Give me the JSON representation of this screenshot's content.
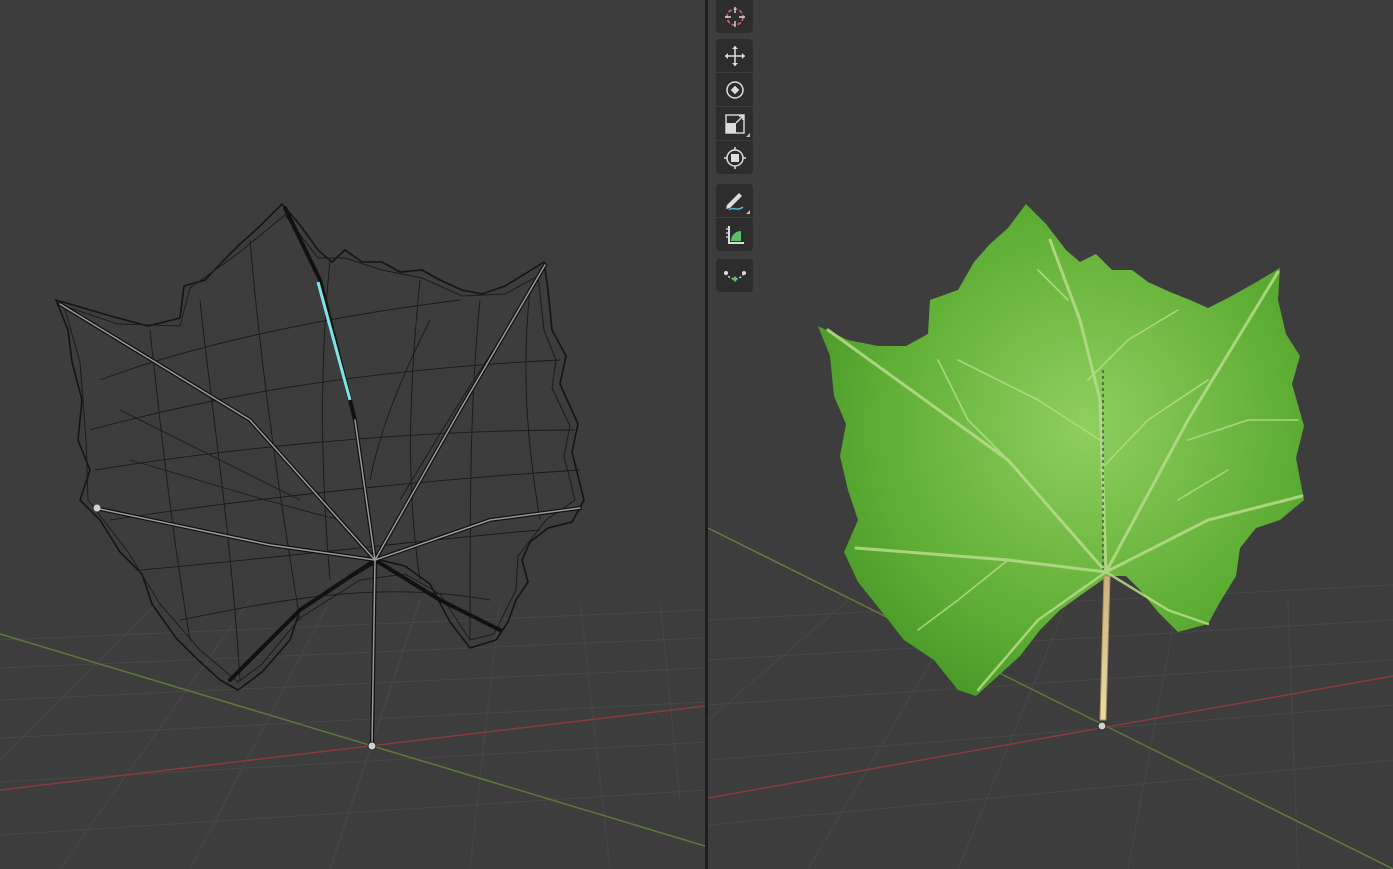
{
  "app": "3D viewport",
  "colors": {
    "background": "#3d3d3d",
    "grid": "#4a4a4a",
    "x_axis": "#8c3a3e",
    "y_axis": "#5e7a3a",
    "wire": "#101010",
    "selected_edge": "#7fe3ea",
    "leaf_green": "#5fae35",
    "toolbar_bg": "#2d2d2d"
  },
  "left_viewport": {
    "shading": "wireframe",
    "object": "leaf-mesh"
  },
  "right_viewport": {
    "shading": "material-preview",
    "object": "leaf-mesh"
  },
  "toolbar": {
    "tools": [
      {
        "id": "cursor",
        "icon": "cursor-icon"
      },
      {
        "id": "move",
        "icon": "move-icon"
      },
      {
        "id": "rotate",
        "icon": "rotate-icon"
      },
      {
        "id": "scale",
        "icon": "scale-icon"
      },
      {
        "id": "transform",
        "icon": "transform-icon"
      },
      {
        "id": "annotate",
        "icon": "annotate-icon"
      },
      {
        "id": "measure",
        "icon": "measure-icon"
      },
      {
        "id": "curve",
        "icon": "curve-icon"
      }
    ]
  }
}
